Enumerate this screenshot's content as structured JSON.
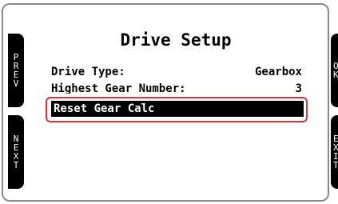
{
  "screen": {
    "title": "Drive Setup",
    "rows": [
      {
        "label": "Drive Type:",
        "value": "Gearbox"
      },
      {
        "label": "Highest Gear Number:",
        "value": "3"
      }
    ],
    "selected_item": {
      "label": "Reset Gear Calc"
    }
  },
  "softkeys": {
    "left": [
      {
        "label": "PREV",
        "letters": [
          "P",
          "R",
          "E",
          "V"
        ]
      },
      {
        "label": "NEXT",
        "letters": [
          "N",
          "E",
          "X",
          "T"
        ]
      }
    ],
    "right": [
      {
        "label": "OK",
        "letters": [
          "O",
          "K"
        ]
      },
      {
        "label": "EXIT",
        "letters": [
          "E",
          "X",
          "I",
          "T"
        ]
      }
    ]
  },
  "colors": {
    "selection_bg": "#000000",
    "highlight_outline": "#d9343b",
    "softkey_bg": "#000000"
  }
}
